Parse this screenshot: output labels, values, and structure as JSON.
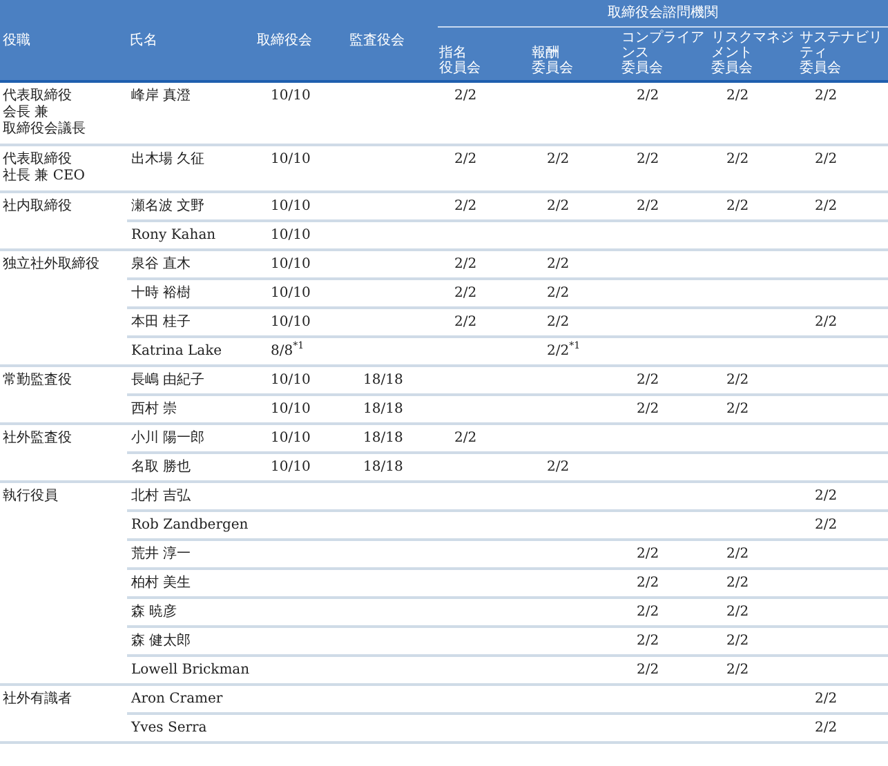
{
  "table": {
    "columns": [
      {
        "label": "役職"
      },
      {
        "label": "氏名"
      },
      {
        "label": "取締役会"
      },
      {
        "label": "監査役会"
      }
    ],
    "group": {
      "label": "取締役会諮問機関",
      "columns": [
        {
          "lines": [
            "指名",
            "役員会"
          ]
        },
        {
          "lines": [
            "報酬",
            "委員会"
          ]
        },
        {
          "lines": [
            "コンプライアンス",
            "委員会"
          ]
        },
        {
          "lines": [
            "リスクマネジメント",
            "委員会"
          ]
        },
        {
          "lines": [
            "サステナビリティ",
            "委員会"
          ]
        }
      ]
    },
    "groups": [
      {
        "role": [
          "代表取締役",
          "会長 兼",
          "取締役会議長"
        ],
        "members": [
          {
            "cells": [
              "峰岸 真澄",
              "10/10",
              null,
              "2/2",
              null,
              "2/2",
              "2/2",
              "2/2"
            ]
          }
        ]
      },
      {
        "role": [
          "代表取締役",
          "社長 兼 CEO"
        ],
        "members": [
          {
            "cells": [
              "出木場 久征",
              "10/10",
              null,
              "2/2",
              "2/2",
              "2/2",
              "2/2",
              "2/2"
            ]
          }
        ]
      },
      {
        "role": [
          "社内取締役"
        ],
        "members": [
          {
            "cells": [
              "瀬名波 文野",
              "10/10",
              null,
              "2/2",
              "2/2",
              "2/2",
              "2/2",
              "2/2"
            ]
          },
          {
            "cells": [
              "Rony Kahan",
              "10/10",
              null,
              null,
              null,
              null,
              null,
              null
            ]
          }
        ]
      },
      {
        "role": [
          "独立社外取締役"
        ],
        "members": [
          {
            "cells": [
              "泉谷 直木",
              "10/10",
              null,
              "2/2",
              "2/2",
              null,
              null,
              null
            ]
          },
          {
            "cells": [
              "十時 裕樹",
              "10/10",
              null,
              "2/2",
              "2/2",
              null,
              null,
              null
            ]
          },
          {
            "cells": [
              "本田 桂子",
              "10/10",
              null,
              "2/2",
              "2/2",
              null,
              null,
              "2/2"
            ]
          },
          {
            "cells": [
              "Katrina Lake",
              "8/8$^{*1}$",
              null,
              null,
              "2/2$^{*1}$",
              null,
              null,
              null
            ]
          }
        ]
      },
      {
        "role": [
          "常勤監査役"
        ],
        "members": [
          {
            "cells": [
              "長嶋 由紀子",
              "10/10",
              "18/18",
              null,
              null,
              "2/2",
              "2/2",
              null
            ]
          },
          {
            "cells": [
              "西村 崇",
              "10/10",
              "18/18",
              null,
              null,
              "2/2",
              "2/2",
              null
            ]
          }
        ]
      },
      {
        "role": [
          "社外監査役"
        ],
        "members": [
          {
            "cells": [
              "小川 陽一郎",
              "10/10",
              "18/18",
              "2/2",
              null,
              null,
              null,
              null
            ]
          },
          {
            "cells": [
              "名取 勝也",
              "10/10",
              "18/18",
              null,
              "2/2",
              null,
              null,
              null
            ]
          }
        ]
      },
      {
        "role": [
          "執行役員"
        ],
        "members": [
          {
            "cells": [
              "北村 吉弘",
              null,
              null,
              null,
              null,
              null,
              null,
              "2/2"
            ]
          },
          {
            "cells": [
              "Rob Zandbergen",
              null,
              null,
              null,
              null,
              null,
              null,
              "2/2"
            ]
          },
          {
            "cells": [
              "荒井 淳一",
              null,
              null,
              null,
              null,
              "2/2",
              "2/2",
              null
            ]
          },
          {
            "cells": [
              "柏村 美生",
              null,
              null,
              null,
              null,
              "2/2",
              "2/2",
              null
            ]
          },
          {
            "cells": [
              "森 暁彦",
              null,
              null,
              null,
              null,
              "2/2",
              "2/2",
              null
            ]
          },
          {
            "cells": [
              "森 健太郎",
              null,
              null,
              null,
              null,
              "2/2",
              "2/2",
              null
            ]
          },
          {
            "cells": [
              "Lowell Brickman",
              null,
              null,
              null,
              null,
              "2/2",
              "2/2",
              null
            ]
          }
        ]
      },
      {
        "role": [
          "社外有識者"
        ],
        "members": [
          {
            "cells": [
              "Aron Cramer",
              null,
              null,
              null,
              null,
              null,
              null,
              "2/2"
            ]
          },
          {
            "cells": [
              "Yves Serra",
              null,
              null,
              null,
              null,
              null,
              null,
              "2/2"
            ]
          }
        ]
      }
    ]
  }
}
